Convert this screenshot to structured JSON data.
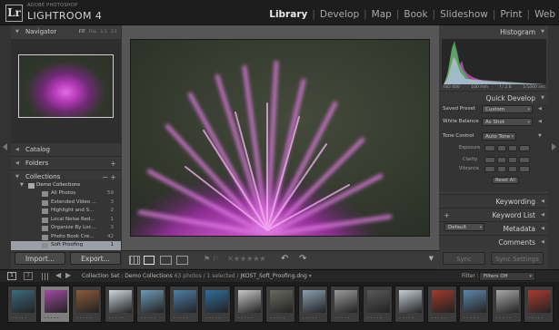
{
  "app": {
    "brand_small": "ADOBE PHOTOSHOP",
    "brand_name": "LIGHTROOM 4",
    "logo": "Lr"
  },
  "modules": {
    "active": "Library",
    "items": [
      "Library",
      "Develop",
      "Map",
      "Book",
      "Slideshow",
      "Print",
      "Web"
    ]
  },
  "left_panel": {
    "navigator": {
      "title": "Navigator",
      "zoom_options": [
        "FIT",
        "FILL",
        "1:1",
        "3:1"
      ],
      "active_zoom": "FIT"
    },
    "catalog": {
      "title": "Catalog"
    },
    "folders": {
      "title": "Folders"
    },
    "collections": {
      "title": "Collections",
      "root": "Demo Collections",
      "items": [
        {
          "label": "All Photos",
          "count": "59"
        },
        {
          "label": "Extended Video ...",
          "count": "3"
        },
        {
          "label": "Highlight and S...",
          "count": "2"
        },
        {
          "label": "Local Noise Red...",
          "count": "1"
        },
        {
          "label": "Organize By Loc...",
          "count": "3"
        },
        {
          "label": "Photo Book Cre...",
          "count": "42"
        },
        {
          "label": "Soft Proofing",
          "count": "1"
        }
      ],
      "selected_index": 6
    },
    "import_label": "Import...",
    "export_label": "Export..."
  },
  "right_panel": {
    "histogram": {
      "title": "Histogram",
      "iso": "ISO 400",
      "focal": "100 mm",
      "aperture": "f / 2.8",
      "shutter": "1/1000 sec"
    },
    "quick_develop": {
      "title": "Quick Develop",
      "saved_preset_label": "Saved Preset",
      "saved_preset_value": "Custom",
      "white_balance_label": "White Balance",
      "white_balance_value": "As Shot",
      "tone_control_label": "Tone Control",
      "auto_tone_label": "Auto Tone",
      "exposure_label": "Exposure",
      "clarity_label": "Clarity",
      "vibrance_label": "Vibrance",
      "reset_label": "Reset All"
    },
    "keywording": {
      "title": "Keywording"
    },
    "keyword_list": {
      "title": "Keyword List"
    },
    "metadata": {
      "title": "Metadata",
      "preset": "Default"
    },
    "comments": {
      "title": "Comments"
    },
    "sync_label": "Sync",
    "sync_settings_label": "Sync Settings"
  },
  "filmstrip_bar": {
    "page1": "1",
    "page2": "2",
    "source": "Collection Set : Demo Collections",
    "count": "63 photos / 1 selected /",
    "filename": "JKOST_Soft_Proofing.dng",
    "filter_label": "Filter :",
    "filter_value": "Filters Off"
  },
  "filmstrip": {
    "selected_index": 1,
    "thumbs": [
      "#3b6a7d",
      "#a24aa3",
      "#8a5a3a",
      "#cfd7de",
      "#6e9ab8",
      "#4e7fa8",
      "#2f6d9a",
      "#c7c7c7",
      "#6a6a62",
      "#89a0b3",
      "#9a9a9a",
      "#585858",
      "#c7ced6",
      "#9f3a2c",
      "#5f86ab",
      "#a8a8a8",
      "#ad3b2f",
      "#8ea8bd"
    ]
  },
  "colors": {
    "flower": "#c44bc4",
    "background": "#3a4034",
    "panel": "#3a3a3a",
    "active_module": "#e8e8e8"
  }
}
